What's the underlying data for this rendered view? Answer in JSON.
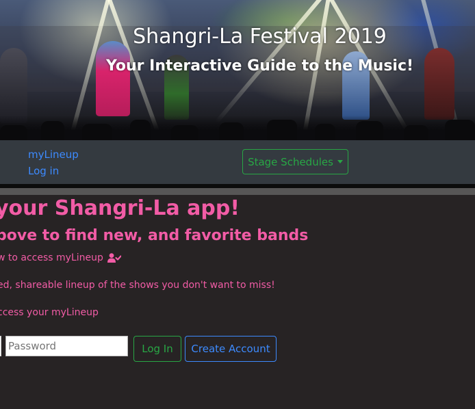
{
  "hero": {
    "title": "Shangri-La Festival 2019",
    "subtitle": "Your Interactive Guide to the Music!"
  },
  "nav": {
    "lineup_link": "myLineup",
    "login_link": "Log in",
    "stage_schedules_label": "Stage Schedules",
    "stage_schedules_icon": "caret-down-icon"
  },
  "main": {
    "heading": "your Shangri-La app!",
    "subheading": "bove to find new, and favorite bands",
    "login_prompt": "w to access myLineup",
    "login_prompt_icon": "user-check-icon",
    "lineup_description": "ed, shareable lineup of the shows you don't want to miss!",
    "access_prompt": "ccess your myLineup"
  },
  "login_form": {
    "password_placeholder": "Password",
    "login_button": "Log In",
    "create_account_button": "Create Account"
  },
  "colors": {
    "accent_pink": "#f25ca6",
    "link_blue": "#3d8bff",
    "success_green": "#28a745",
    "navbar_bg": "#343a40",
    "page_bg": "#272324"
  }
}
